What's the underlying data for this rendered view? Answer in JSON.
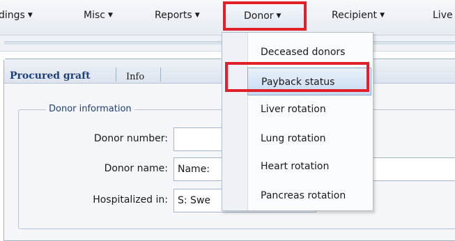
{
  "menubar": {
    "items": [
      {
        "label": "dings",
        "caret": "▼"
      },
      {
        "label": "Misc",
        "caret": "▼"
      },
      {
        "label": "Reports",
        "caret": "▼"
      },
      {
        "label": "Donor",
        "caret": "▼"
      },
      {
        "label": "Recipient",
        "caret": "▼"
      },
      {
        "label": "Live"
      }
    ]
  },
  "donor_menu": {
    "items": [
      {
        "label": "Deceased donors"
      },
      {
        "label": "Payback status",
        "selected": true
      },
      {
        "label": "Liver rotation"
      },
      {
        "label": "Lung rotation"
      },
      {
        "label": "Heart rotation"
      },
      {
        "label": "Pancreas rotation"
      }
    ]
  },
  "tabs": [
    {
      "label": "Procured graft",
      "active": true
    },
    {
      "label": "Info",
      "active": false
    }
  ],
  "form": {
    "group_title": "Donor information",
    "fields": [
      {
        "label": "Donor number:",
        "value": ""
      },
      {
        "label": "Donor name:",
        "value": "Name:"
      },
      {
        "label": "Hospitalized in:",
        "value": "S: Swe"
      }
    ]
  },
  "colors": {
    "highlight": "#e0212a",
    "accent": "#1f3f7a",
    "selection": "#c7daf2"
  },
  "icons": {
    "menu_caret": "chevron-down-icon"
  }
}
